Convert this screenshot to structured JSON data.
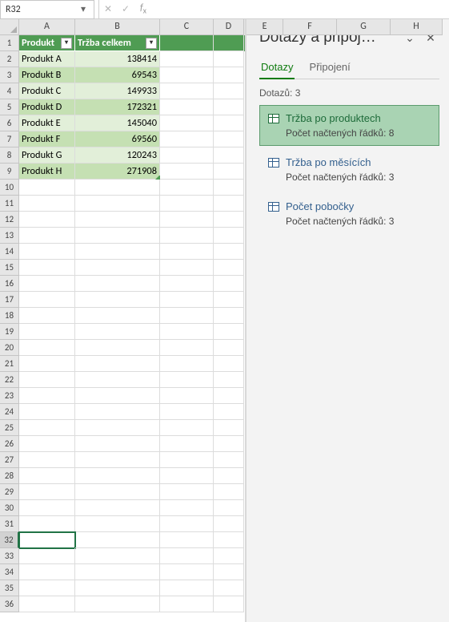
{
  "namebox": {
    "value": "R32"
  },
  "formula": "",
  "columns": [
    "A",
    "B",
    "C",
    "D",
    "E",
    "F",
    "G",
    "H"
  ],
  "table": {
    "headers": {
      "col1": "Produkt",
      "col2": "Tržba celkem"
    },
    "rows": [
      {
        "p": "Produkt A",
        "v": "138414"
      },
      {
        "p": "Produkt B",
        "v": "69543"
      },
      {
        "p": "Produkt C",
        "v": "149933"
      },
      {
        "p": "Produkt D",
        "v": "172321"
      },
      {
        "p": "Produkt E",
        "v": "145040"
      },
      {
        "p": "Produkt F",
        "v": "69560"
      },
      {
        "p": "Produkt G",
        "v": "120243"
      },
      {
        "p": "Produkt H",
        "v": "271908"
      }
    ]
  },
  "pane": {
    "title": "Dotazy a připoj…",
    "tabs": {
      "t1": "Dotazy",
      "t2": "Připojení"
    },
    "count_label": "Dotazů: 3",
    "queries": [
      {
        "name": "Tržba po produktech",
        "sub": "Počet načtených řádků: 8",
        "selected": true
      },
      {
        "name": "Tržba po měsících",
        "sub": "Počet načtených řádků: 3",
        "selected": false
      },
      {
        "name": "Počet pobočky",
        "sub": "Počet načtených řádků: 3",
        "selected": false
      }
    ]
  },
  "active_row": 32,
  "total_rows": 36
}
